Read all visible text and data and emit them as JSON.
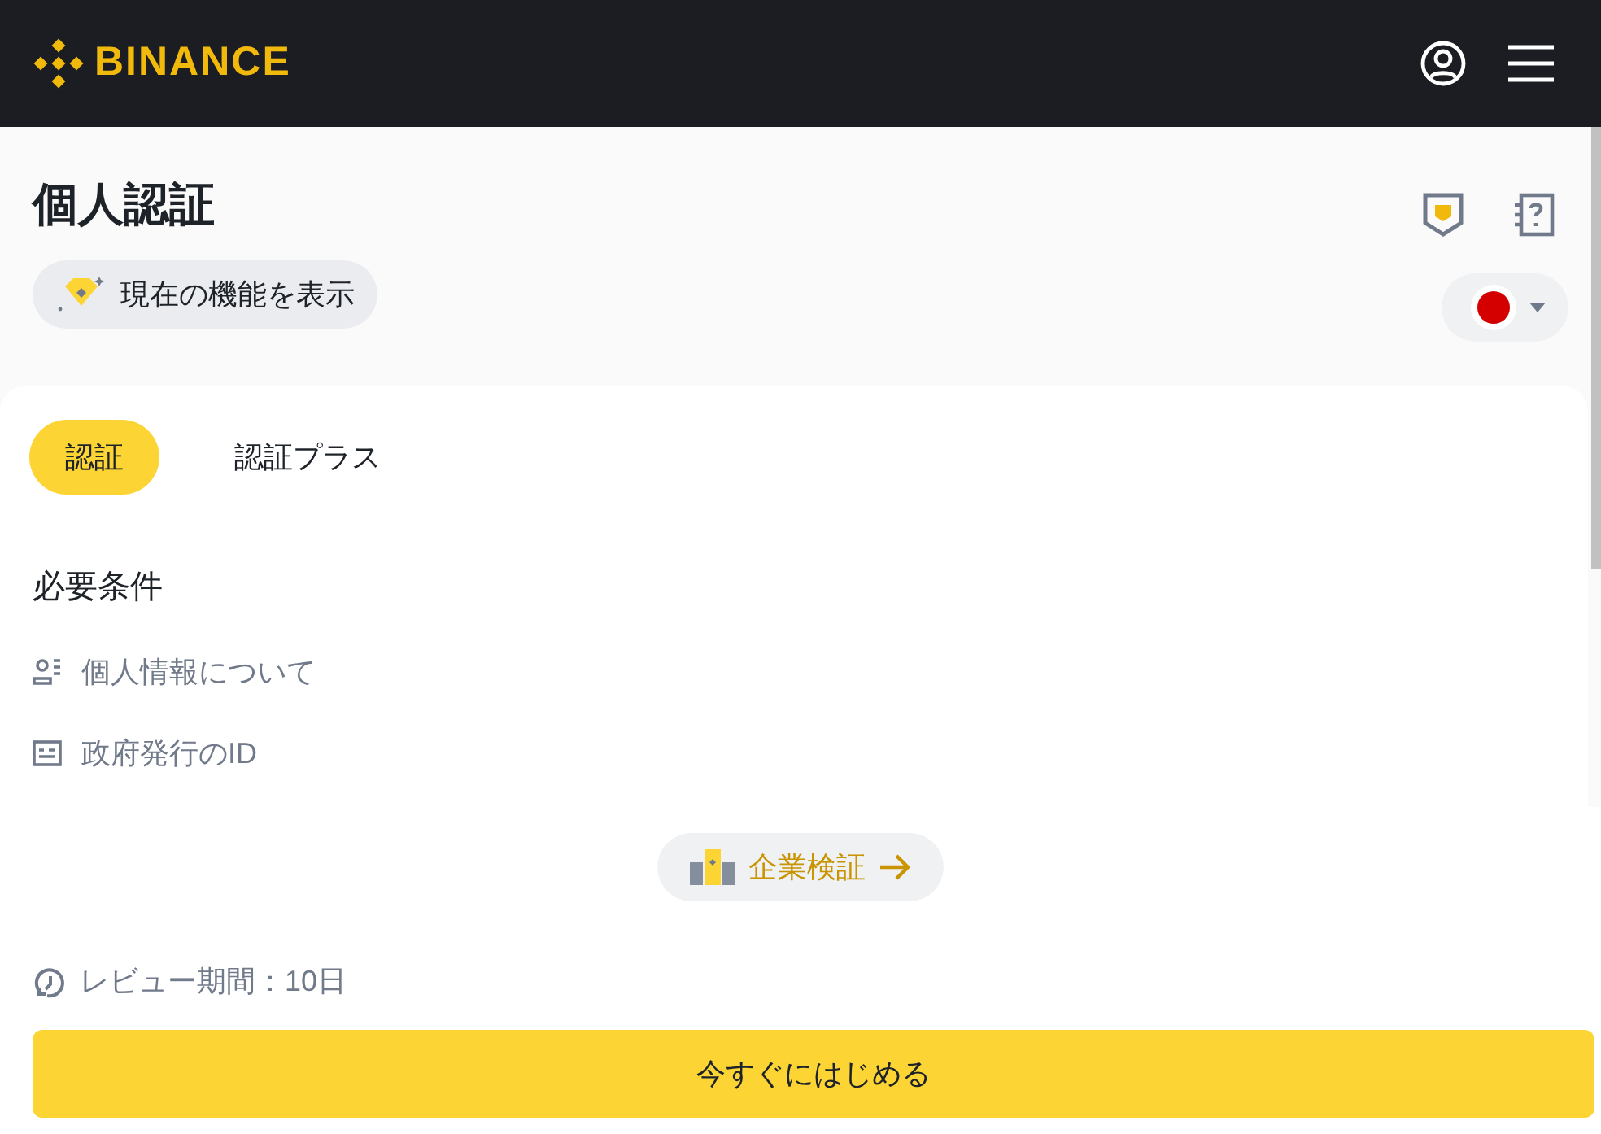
{
  "header": {
    "logo_text": "BINANCE"
  },
  "page": {
    "title": "個人認証",
    "features_button": "現在の機能を表示"
  },
  "tabs": [
    {
      "label": "認証",
      "selected": true
    },
    {
      "label": "認証プラス",
      "selected": false
    }
  ],
  "requirements": {
    "heading": "必要条件",
    "items": [
      {
        "kind": "person",
        "label": "個人情報について"
      },
      {
        "kind": "id",
        "label": "政府発行のID"
      }
    ]
  },
  "business_link": "企業検証",
  "review_period": "レビュー期間：10日",
  "start_button": "今すぐにはじめる"
}
